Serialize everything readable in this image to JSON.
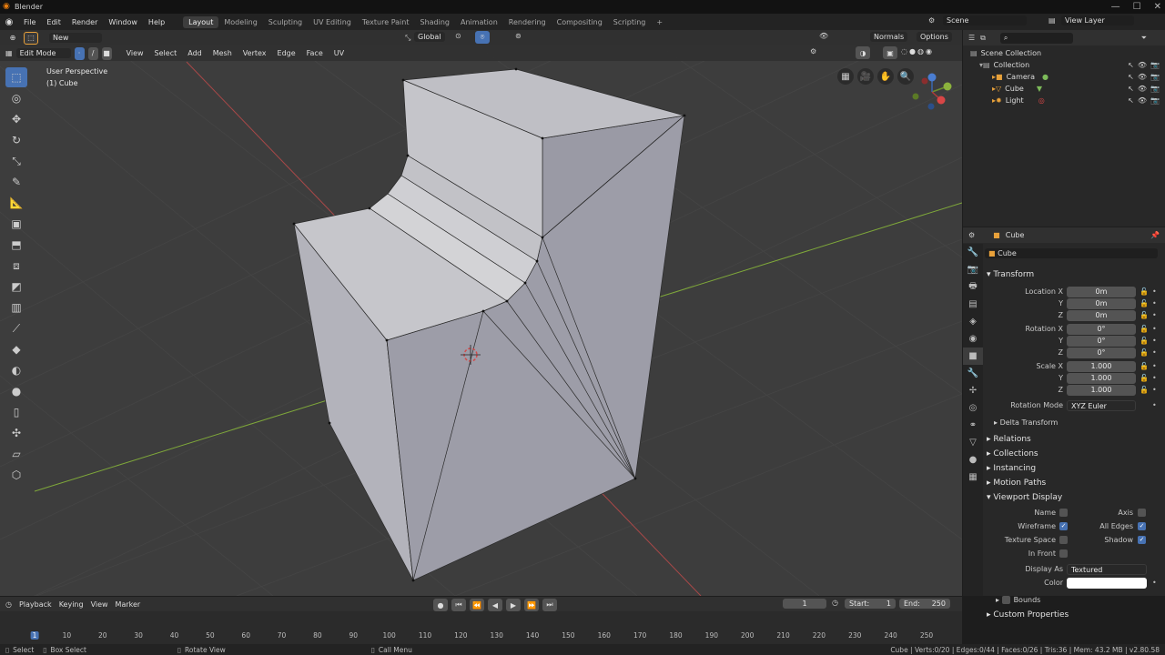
{
  "window": {
    "title": "Blender"
  },
  "menu": [
    "File",
    "Edit",
    "Render",
    "Window",
    "Help"
  ],
  "workspaces": [
    "Layout",
    "Modeling",
    "Sculpting",
    "UV Editing",
    "Texture Paint",
    "Shading",
    "Animation",
    "Rendering",
    "Compositing",
    "Scripting"
  ],
  "active_workspace": "Layout",
  "scene_field": "Scene",
  "view_layer_field": "View Layer",
  "tool_header": {
    "new_label": "New",
    "orientation": "Global",
    "normals": "Normals",
    "options": "Options"
  },
  "mode_header": {
    "mode": "Edit Mode",
    "menus": [
      "View",
      "Select",
      "Add",
      "Mesh",
      "Vertex",
      "Edge",
      "Face",
      "UV"
    ]
  },
  "viewport_info": {
    "perspective": "User Perspective",
    "object": "(1) Cube"
  },
  "outliner": {
    "root": "Scene Collection",
    "collection": "Collection",
    "items": [
      {
        "name": "Camera"
      },
      {
        "name": "Cube"
      },
      {
        "name": "Light"
      }
    ]
  },
  "properties": {
    "object_name": "Cube",
    "object_field": "Cube",
    "transform_title": "Transform",
    "location": {
      "label": "Location X",
      "x": "0m",
      "y": "0m",
      "z": "0m"
    },
    "rotation": {
      "label": "Rotation X",
      "x": "0°",
      "y": "0°",
      "z": "0°"
    },
    "scale": {
      "label": "Scale X",
      "x": "1.000",
      "y": "1.000",
      "z": "1.000"
    },
    "axis_y": "Y",
    "axis_z": "Z",
    "rotation_mode_label": "Rotation Mode",
    "rotation_mode": "XYZ Euler",
    "delta_transform": "Delta Transform",
    "sections": [
      "Relations",
      "Collections",
      "Instancing",
      "Motion Paths",
      "Viewport Display"
    ],
    "viewport_display": {
      "name": "Name",
      "axis": "Axis",
      "wireframe": "Wireframe",
      "all_edges": "All Edges",
      "texture_space": "Texture Space",
      "shadow": "Shadow",
      "in_front": "In Front",
      "display_as_label": "Display As",
      "display_as": "Textured",
      "color_label": "Color",
      "color": "#ffffff"
    },
    "bounds": "Bounds",
    "custom_properties": "Custom Properties"
  },
  "timeline": {
    "menus": [
      "Playback",
      "Keying",
      "View",
      "Marker"
    ],
    "current_frame": "1",
    "start_label": "Start:",
    "start": "1",
    "end_label": "End:",
    "end": "250",
    "ticks": [
      "1",
      "10",
      "20",
      "30",
      "40",
      "50",
      "60",
      "70",
      "80",
      "90",
      "100",
      "110",
      "120",
      "130",
      "140",
      "150",
      "160",
      "170",
      "180",
      "190",
      "200",
      "210",
      "220",
      "230",
      "240",
      "250"
    ]
  },
  "statusbar": {
    "select": "Select",
    "box_select": "Box Select",
    "rotate_view": "Rotate View",
    "call_menu": "Call Menu",
    "stats": "Cube | Verts:0/20 | Edges:0/44 | Faces:0/26 | Tris:36 | Mem: 43.2 MB | v2.80.58"
  },
  "colors": {
    "accent": "#4772b3",
    "x_axis": "#c44848",
    "y_axis": "#7fa83a",
    "background": "#3d3d3d"
  }
}
